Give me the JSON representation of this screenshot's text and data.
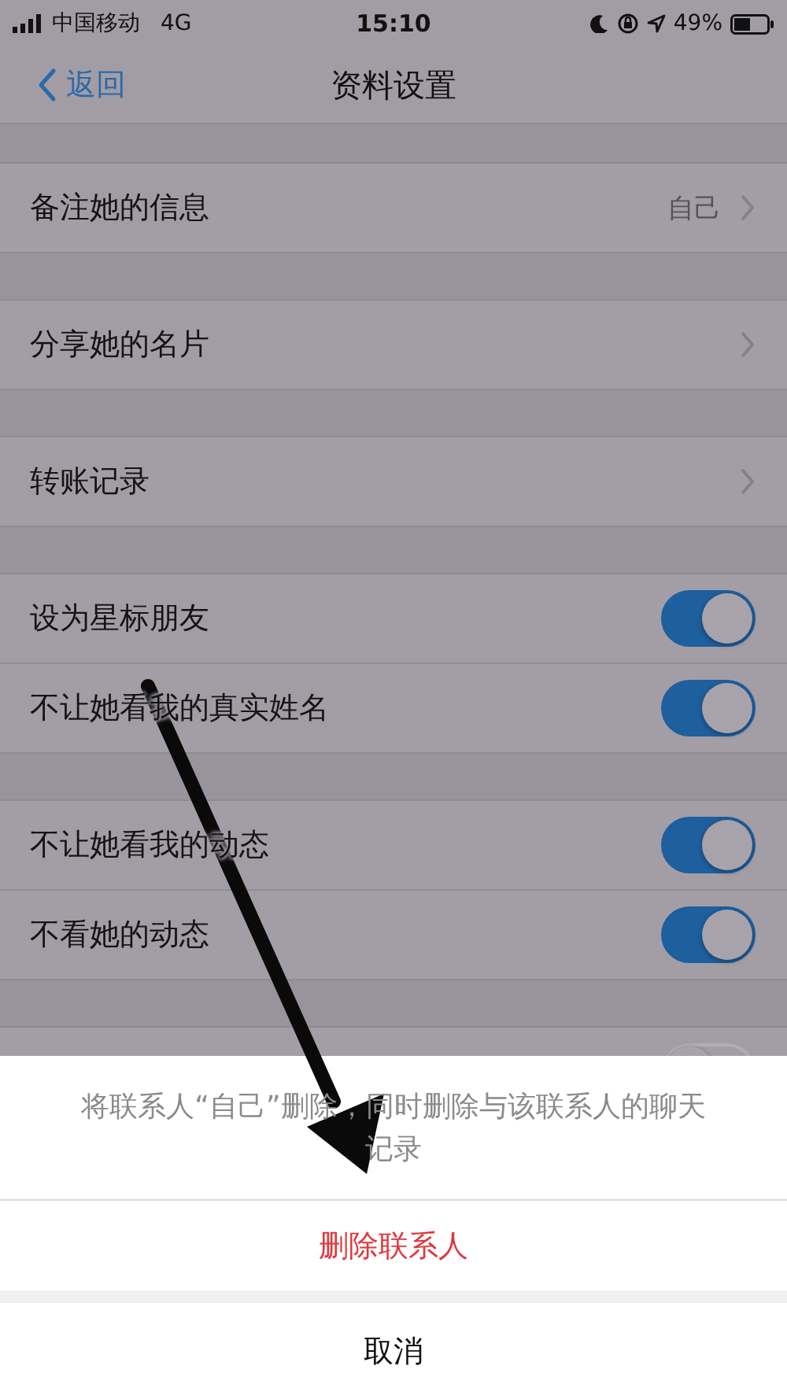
{
  "status_bar": {
    "carrier": "中国移动",
    "network": "4G",
    "time": "15:10",
    "battery": "49%"
  },
  "nav": {
    "back": "返回",
    "title": "资料设置"
  },
  "groups": [
    [
      {
        "kind": "link",
        "label": "备注她的信息",
        "value": "自己"
      }
    ],
    [
      {
        "kind": "link",
        "label": "分享她的名片"
      }
    ],
    [
      {
        "kind": "link",
        "label": "转账记录"
      }
    ],
    [
      {
        "kind": "toggle",
        "label": "设为星标朋友",
        "on": true
      },
      {
        "kind": "toggle",
        "label": "不让她看我的真实姓名",
        "on": true
      }
    ],
    [
      {
        "kind": "toggle",
        "label": "不让她看我的动态",
        "on": true
      },
      {
        "kind": "toggle",
        "label": "不看她的动态",
        "on": true
      }
    ],
    [
      {
        "kind": "toggle",
        "on": false
      }
    ]
  ],
  "sheet": {
    "message": "将联系人“自己”删除，同时删除与该联系人的聊天记录",
    "actions": [
      {
        "label": "删除联系人",
        "kind": "destructive"
      }
    ],
    "cancel": "取消"
  }
}
